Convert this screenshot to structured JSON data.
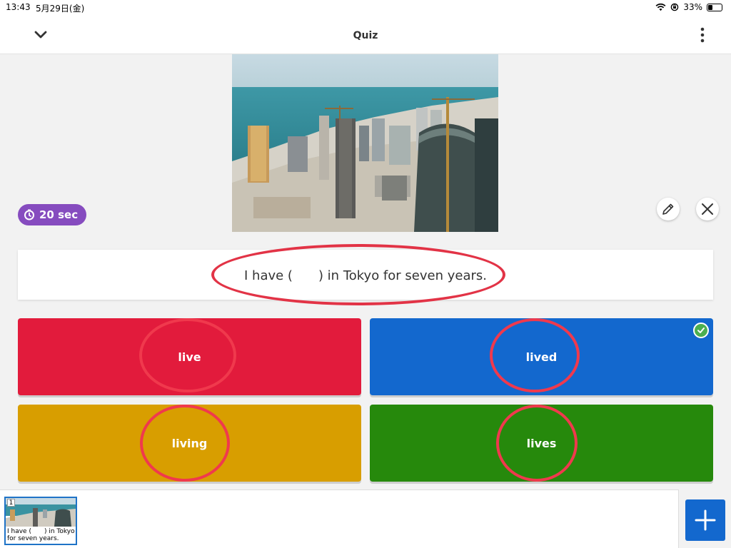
{
  "status_bar": {
    "time": "13:43",
    "date": "5月29日(金)",
    "battery": "33%",
    "battery_level": 0.33
  },
  "header": {
    "title": "Quiz"
  },
  "timer": {
    "label": "20 sec"
  },
  "question": {
    "text": "I have (　　) in Tokyo for seven years."
  },
  "answers": [
    {
      "label": "live",
      "color": "#e21b3c",
      "correct": false
    },
    {
      "label": "lived",
      "color": "#1368ce",
      "correct": true
    },
    {
      "label": "living",
      "color": "#d89e00",
      "correct": false
    },
    {
      "label": "lives",
      "color": "#26890c",
      "correct": false
    }
  ],
  "slides": [
    {
      "number": "1",
      "caption": "I have (　　) in Tokyo\nfor seven years."
    }
  ],
  "icons": {
    "collapse": "chevron-down-icon",
    "more": "more-vertical-icon",
    "timer": "clock-icon",
    "edit": "pencil-icon",
    "close": "close-icon",
    "correct": "check-circle-icon",
    "add": "plus-icon"
  },
  "colors": {
    "timer_bg": "#864cbf",
    "add_button": "#1368ce",
    "annotation_ring": "#e23346"
  }
}
